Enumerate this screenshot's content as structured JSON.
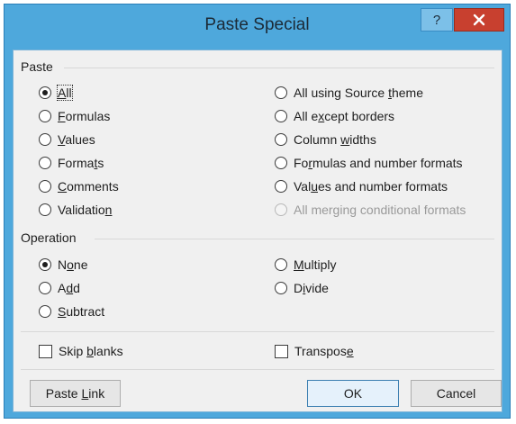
{
  "window": {
    "title": "Paste Special",
    "help": "?",
    "close": "x"
  },
  "paste": {
    "label": "Paste",
    "left": [
      {
        "pre": "",
        "u": "A",
        "post": "ll",
        "checked": true
      },
      {
        "pre": "",
        "u": "F",
        "post": "ormulas"
      },
      {
        "pre": "",
        "u": "V",
        "post": "alues"
      },
      {
        "pre": "Forma",
        "u": "t",
        "post": "s"
      },
      {
        "pre": "",
        "u": "C",
        "post": "omments"
      },
      {
        "pre": "Validatio",
        "u": "n",
        "post": ""
      }
    ],
    "right": [
      {
        "pre": "All using Source ",
        "u": "t",
        "post": "heme"
      },
      {
        "pre": "All e",
        "u": "x",
        "post": "cept borders"
      },
      {
        "pre": "Column ",
        "u": "w",
        "post": "idths"
      },
      {
        "pre": "Fo",
        "u": "r",
        "post": "mulas and number formats"
      },
      {
        "pre": "Val",
        "u": "u",
        "post": "es and number formats"
      },
      {
        "pre": "All merging conditional formats",
        "u": "",
        "post": "",
        "disabled": true
      }
    ]
  },
  "operation": {
    "label": "Operation",
    "left": [
      {
        "pre": "N",
        "u": "o",
        "post": "ne",
        "checked": true
      },
      {
        "pre": "A",
        "u": "d",
        "post": "d"
      },
      {
        "pre": "",
        "u": "S",
        "post": "ubtract"
      }
    ],
    "right": [
      {
        "pre": "",
        "u": "M",
        "post": "ultiply"
      },
      {
        "pre": "D",
        "u": "i",
        "post": "vide"
      }
    ]
  },
  "options": {
    "skip_blanks": {
      "pre": "Skip ",
      "u": "b",
      "post": "lanks"
    },
    "transpose": {
      "pre": "Transpos",
      "u": "e",
      "post": ""
    }
  },
  "buttons": {
    "paste_link": {
      "pre": "Paste ",
      "u": "L",
      "post": "ink"
    },
    "ok": "OK",
    "cancel": "Cancel"
  }
}
